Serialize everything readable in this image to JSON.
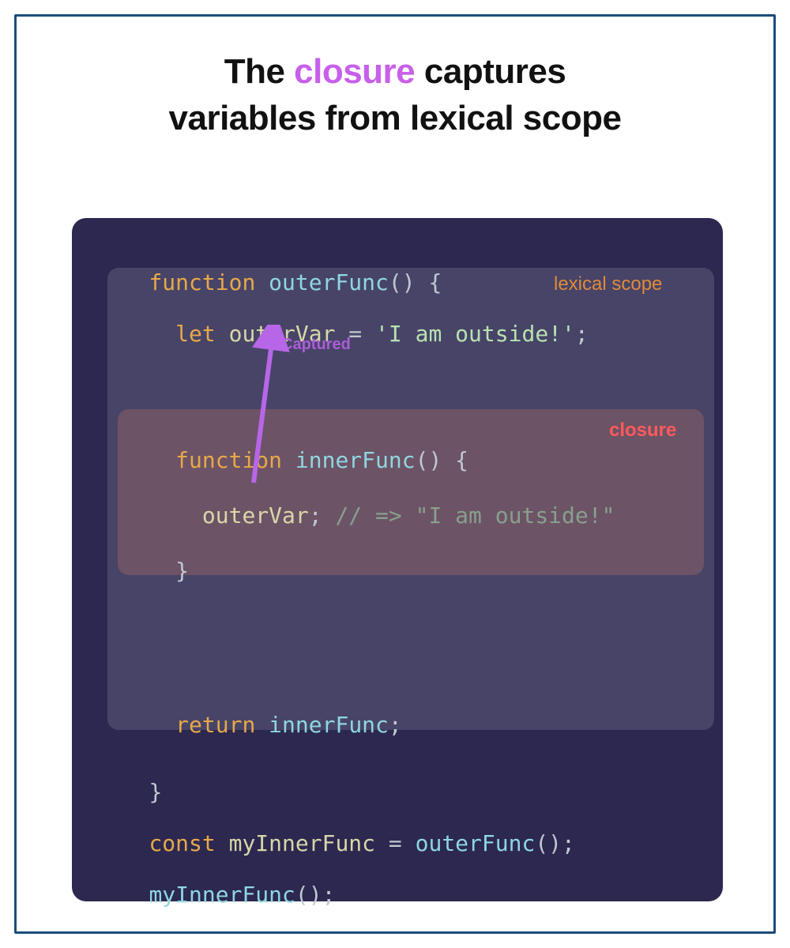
{
  "title": {
    "pre": "The ",
    "hl": "closure",
    "post": " captures",
    "line2": "variables from lexical scope"
  },
  "labels": {
    "lexical": "lexical scope",
    "closure": "closure",
    "captured": "Captured"
  },
  "code": {
    "l1": {
      "kw": "function",
      "sp": " ",
      "fn": "outerFunc",
      "rest": "() {"
    },
    "l2": {
      "ind": "  ",
      "kw": "let",
      "sp": " ",
      "var": "outerVar",
      "eq": " = ",
      "str": "'I am outside!'",
      "semi": ";"
    },
    "l3": {
      "ind": "  ",
      "kw": "function",
      "sp": " ",
      "fn": "innerFunc",
      "rest": "() {"
    },
    "l4": {
      "ind": "    ",
      "var": "outerVar",
      "semi": "; ",
      "cmt": "// => \"I am outside!\""
    },
    "l5": {
      "ind": "  ",
      "brace": "}"
    },
    "l6": {
      "ind": "  ",
      "kw": "return",
      "sp": " ",
      "fn": "innerFunc",
      "semi": ";"
    },
    "l7": {
      "brace": "}"
    },
    "l8": {
      "kw": "const",
      "sp": " ",
      "var": "myInnerFunc",
      "eq": " = ",
      "fn": "outerFunc",
      "rest": "();"
    },
    "l9": {
      "fn": "myInnerFunc",
      "rest": "();"
    }
  },
  "colors": {
    "frame_border": "#1a4d7a",
    "codebox_bg": "#2c2850",
    "title_hl": "#c760ea",
    "keyword": "#e6a84a",
    "funcname": "#8fd6e0",
    "string": "#b8e2b0",
    "comment": "#88a08c",
    "lexical_label": "#e08a3a",
    "closure_label": "#ff5a5a",
    "arrow": "#b866e8"
  }
}
